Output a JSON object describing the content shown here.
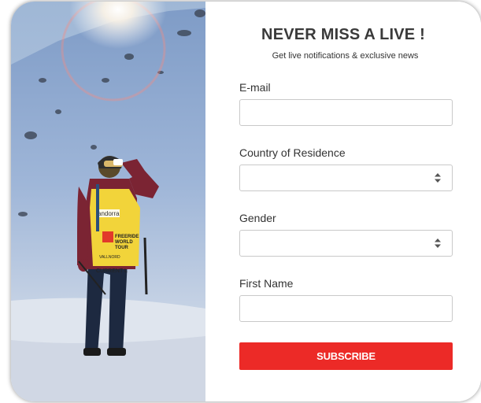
{
  "headline": "NEVER MISS A LIVE !",
  "subheadline": "Get live notifications & exclusive news",
  "fields": {
    "email": {
      "label": "E-mail",
      "value": "",
      "placeholder": ""
    },
    "country": {
      "label": "Country of Residence",
      "selected": ""
    },
    "gender": {
      "label": "Gender",
      "selected": ""
    },
    "first_name": {
      "label": "First Name",
      "value": "",
      "placeholder": ""
    }
  },
  "subscribe_label": "SUBSCRIBE",
  "photo": {
    "description_icon": "skier-photo",
    "bib_text_lines": [
      "andorra",
      "FREERIDE",
      "WORLD",
      "TOUR",
      "VALLNORD",
      "CURRENT L"
    ]
  },
  "colors": {
    "accent": "#ec2a27",
    "title": "#3a3a3a",
    "input_border": "#c9c9c9",
    "bib_yellow": "#f2d43a"
  }
}
